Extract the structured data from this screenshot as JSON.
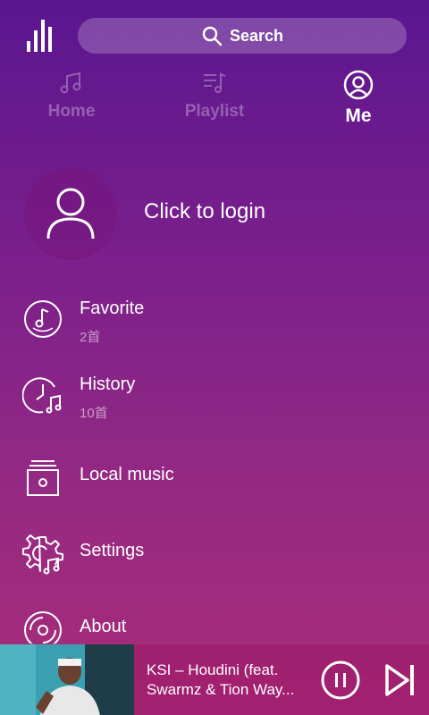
{
  "colors": {
    "bg_top": "#5a1690",
    "bg_bottom": "#a82c78",
    "text": "#ffffff"
  },
  "header": {
    "equalizer_icon": "equalizer-bars-icon",
    "search": {
      "label": "Search",
      "icon": "search-icon"
    }
  },
  "tabs": [
    {
      "label": "Home",
      "icon": "music-note-icon",
      "active": false
    },
    {
      "label": "Playlist",
      "icon": "playlist-icon",
      "active": false
    },
    {
      "label": "Me",
      "icon": "user-circle-icon",
      "active": true
    }
  ],
  "login": {
    "label": "Click to login",
    "icon": "user-avatar-icon"
  },
  "menu": [
    {
      "title": "Favorite",
      "subtitle": "2首",
      "icon": "favorite-disc-icon"
    },
    {
      "title": "History",
      "subtitle": "10首",
      "icon": "history-clock-icon"
    },
    {
      "title": "Local music",
      "subtitle": "",
      "icon": "local-music-box-icon"
    },
    {
      "title": "Settings",
      "subtitle": "",
      "icon": "settings-gear-icon"
    },
    {
      "title": "About",
      "subtitle": "",
      "icon": "about-disc-icon"
    }
  ],
  "player": {
    "song_title": "KSI – Houdini (feat. Swarmz & Tion Way...",
    "play_icon": "pause-icon",
    "next_icon": "skip-next-icon",
    "thumbnail": "album-art-thumbnail"
  }
}
